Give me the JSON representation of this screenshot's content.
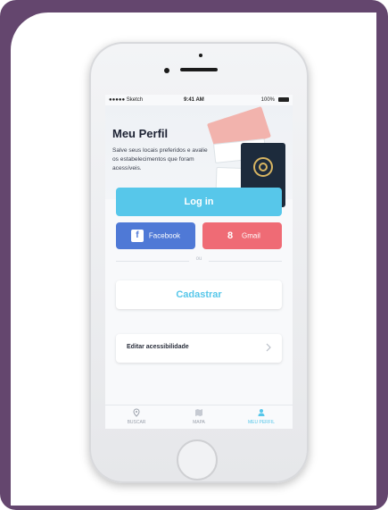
{
  "status": {
    "carrier": "●●●●● Sketch",
    "time": "9:41 AM",
    "battery": "100%"
  },
  "profile": {
    "title": "Meu Perfil",
    "subtitle": "Salve seus locais preferidos e avalie os estabelecimentos que foram acessíveis."
  },
  "buttons": {
    "login": "Log in",
    "facebook": "Facebook",
    "gmail": "Gmail",
    "or": "ou",
    "register": "Cadastrar"
  },
  "settings": {
    "accessibility": "Editar acessibilidade"
  },
  "tabs": [
    {
      "label": "BUSCAR",
      "icon": "location-pin-icon"
    },
    {
      "label": "MAPA",
      "icon": "map-icon"
    },
    {
      "label": "MEU PERFIL",
      "icon": "user-icon"
    }
  ],
  "colors": {
    "accent": "#57c7ea",
    "facebook": "#4f79d6",
    "gmail": "#ef6b75",
    "frame": "#64466e"
  }
}
